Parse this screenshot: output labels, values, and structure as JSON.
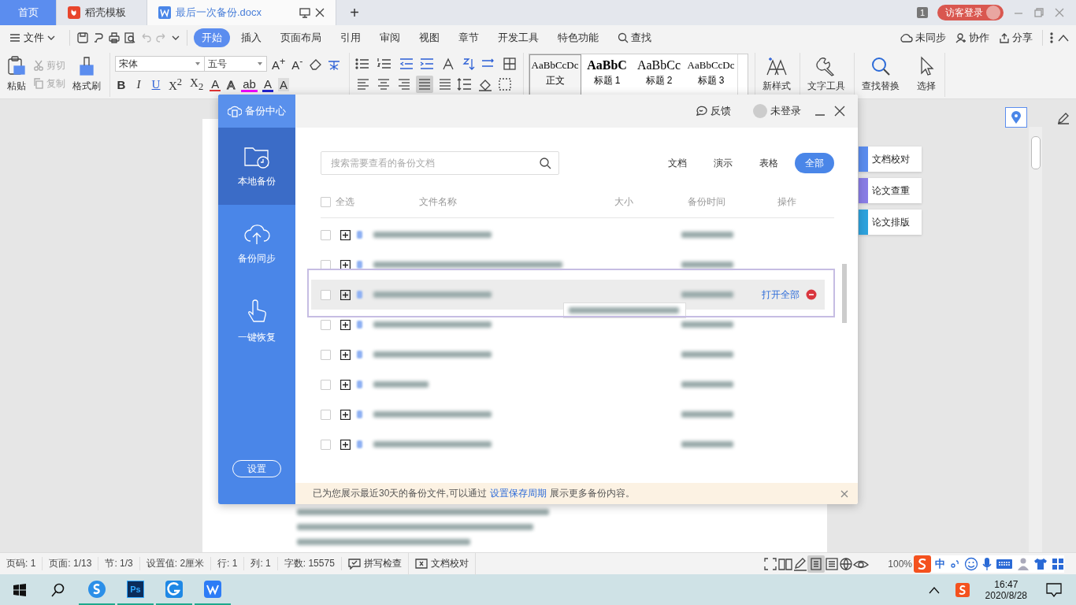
{
  "tabs": [
    {
      "label": "首页",
      "kind": "home",
      "selected": false
    },
    {
      "label": "稻壳模板",
      "kind": "docer",
      "selected": false
    },
    {
      "label": "最后一次备份.docx",
      "kind": "doc",
      "selected": true
    }
  ],
  "new_tab": "+",
  "notification_count": "1",
  "login_button": "访客登录",
  "menu": {
    "file": "文件",
    "tabs": [
      {
        "label": "开始",
        "selected": true
      },
      {
        "label": "插入",
        "selected": false
      },
      {
        "label": "页面布局",
        "selected": false
      },
      {
        "label": "引用",
        "selected": false
      },
      {
        "label": "审阅",
        "selected": false
      },
      {
        "label": "视图",
        "selected": false
      },
      {
        "label": "章节",
        "selected": false
      },
      {
        "label": "开发工具",
        "selected": false
      },
      {
        "label": "特色功能",
        "selected": false
      }
    ],
    "search": "查找",
    "sync": "未同步",
    "collab": "协作",
    "share": "分享"
  },
  "ribbon": {
    "paste": "粘贴",
    "clipboard": [
      {
        "label": "剪切",
        "disabled": true
      },
      {
        "label": "复制",
        "disabled": true
      }
    ],
    "format_painter": "格式刷",
    "font": "宋体",
    "size": "五号",
    "grow": "A$^{+}$",
    "shrink": "A$^{-}$",
    "format_buttons": [
      "B",
      "I",
      "U",
      "X$^{2}$",
      "X$_{2}$"
    ],
    "text_effects": [
      {
        "label": "A",
        "kind": "strike"
      },
      {
        "label": "A",
        "kind": "outline"
      },
      {
        "label": "ab",
        "kind": "highlight"
      },
      {
        "label": "A",
        "kind": "color"
      },
      {
        "label": "A",
        "kind": "shade"
      }
    ],
    "align": [
      {
        "kind": "left",
        "selected": false
      },
      {
        "kind": "center",
        "selected": false
      },
      {
        "kind": "right",
        "selected": false
      },
      {
        "kind": "justify",
        "selected": true
      },
      {
        "kind": "distributed",
        "selected": false
      }
    ],
    "styles": [
      {
        "sample": "AaBbCcDc",
        "label": "正文",
        "kind": "body",
        "selected": true
      },
      {
        "sample": "AaBbC",
        "label": "标题 1",
        "kind": "h1",
        "selected": false
      },
      {
        "sample": "AaBbCc",
        "label": "标题 2",
        "kind": "h2",
        "selected": false
      },
      {
        "sample": "AaBbCcDc",
        "label": "标题 3",
        "kind": "h3",
        "selected": false
      }
    ],
    "new_style": "新样式",
    "text_tools": "文字工具",
    "find_replace": "查找替换",
    "select": "选择"
  },
  "side_tools": [
    {
      "label": "文档校对",
      "color": "#5b8def"
    },
    {
      "label": "论文查重",
      "color": "#8a7de6"
    },
    {
      "label": "论文排版",
      "color": "#2ea3de"
    }
  ],
  "dialog": {
    "title": "备份中心",
    "feedback": "反馈",
    "account": "未登录",
    "nav": [
      {
        "label": "本地备份",
        "kind": "local",
        "selected": true
      },
      {
        "label": "备份同步",
        "kind": "sync",
        "selected": false
      },
      {
        "label": "一键恢复",
        "kind": "restore",
        "selected": false
      }
    ],
    "settings": "设置",
    "search_placeholder": "搜索需要查看的备份文档",
    "filters": [
      {
        "label": "文档",
        "selected": false
      },
      {
        "label": "演示",
        "selected": false
      },
      {
        "label": "表格",
        "selected": false
      },
      {
        "label": "全部",
        "selected": true
      }
    ],
    "columns": {
      "select_all": "全选",
      "name": "文件名称",
      "size": "大小",
      "time": "备份时间",
      "actions": "操作"
    },
    "select_all_checked": false,
    "rows": [
      {
        "checked": false,
        "expanded": false,
        "hovered": false
      },
      {
        "checked": false,
        "expanded": false,
        "hovered": false
      },
      {
        "checked": false,
        "expanded": false,
        "hovered": true,
        "action": "打开全部"
      },
      {
        "checked": false,
        "expanded": false,
        "hovered": false
      },
      {
        "checked": false,
        "expanded": false,
        "hovered": false
      },
      {
        "checked": false,
        "expanded": false,
        "hovered": false
      },
      {
        "checked": false,
        "expanded": false,
        "hovered": false
      },
      {
        "checked": false,
        "expanded": false,
        "hovered": false
      }
    ],
    "notice": "已为您展示最近30天的备份文件,可以通过",
    "notice_link": "设置保存周期",
    "notice_end": "展示更多备份内容。"
  },
  "status_bar": {
    "items": [
      "页码: 1",
      "页面: 1/13",
      "节: 1/3",
      "设置值: 2厘米",
      "行: 1",
      "列: 1",
      "字数: 15575"
    ],
    "spell_check": "拼写检查",
    "proofread": "文档校对",
    "zoom": "100%",
    "ime_mode": "中"
  },
  "taskbar": {
    "apps": [
      {
        "kind": "browser"
      },
      {
        "kind": "ps",
        "label": "Ps"
      },
      {
        "kind": "g"
      },
      {
        "kind": "wps"
      }
    ],
    "time": "16:47",
    "date": "2020/8/28"
  }
}
